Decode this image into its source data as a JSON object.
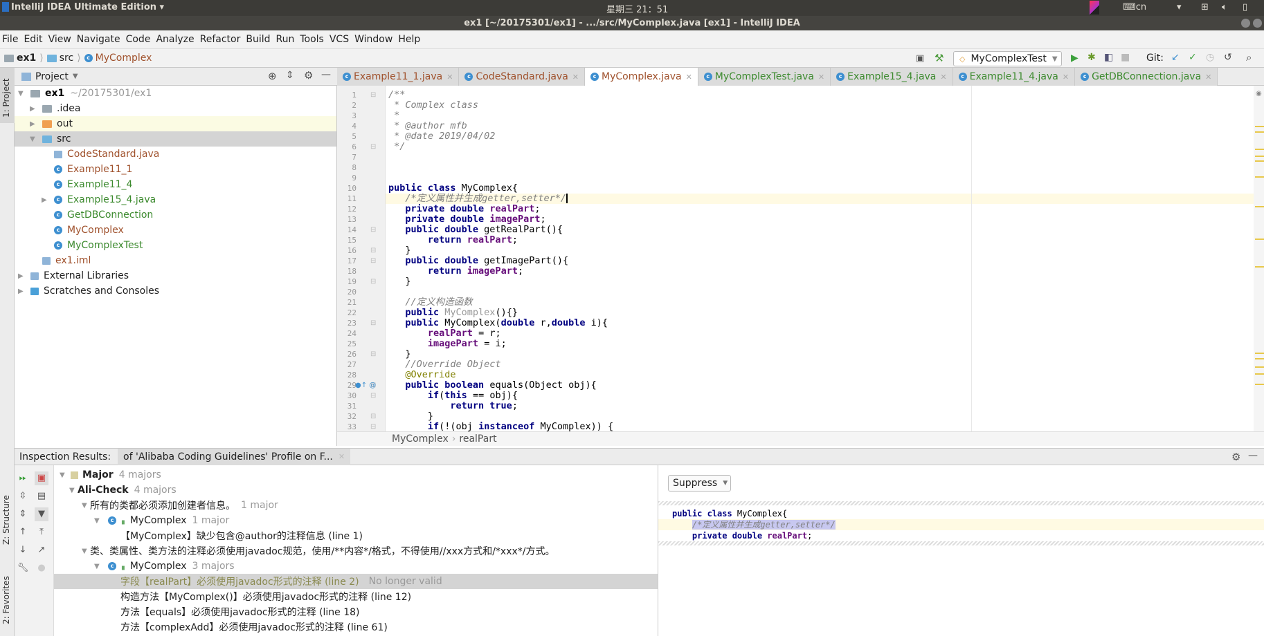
{
  "system_bar": {
    "app_name": "IntelliJ IDEA Ultimate Edition",
    "clock": "星期三 21：51",
    "input_method": "cn"
  },
  "window_title": "ex1 [~/20175301/ex1] - .../src/MyComplex.java [ex1] - IntelliJ IDEA",
  "menu": [
    "File",
    "Edit",
    "View",
    "Navigate",
    "Code",
    "Analyze",
    "Refactor",
    "Build",
    "Run",
    "Tools",
    "VCS",
    "Window",
    "Help"
  ],
  "nav": {
    "crumbs": [
      "ex1",
      "src",
      "MyComplex"
    ],
    "run_config": "MyComplexTest",
    "git_label": "Git:"
  },
  "side_tabs": {
    "project": "1: Project",
    "structure": "Z: Structure",
    "favorites": "2: Favorites"
  },
  "project": {
    "title": "Project",
    "items": [
      {
        "label": "ex1",
        "extra": "~/20175301/ex1",
        "depth": 0,
        "arrow": "down",
        "icon": "module-folder",
        "color": "#000",
        "bold": true
      },
      {
        "label": ".idea",
        "depth": 1,
        "arrow": "right",
        "icon": "folder",
        "color": "#222"
      },
      {
        "label": "out",
        "depth": 1,
        "arrow": "right",
        "icon": "folder-orange",
        "color": "#222",
        "highlight": "yellow"
      },
      {
        "label": "src",
        "depth": 1,
        "arrow": "down",
        "icon": "folder-blue",
        "color": "#222",
        "highlight": "selected"
      },
      {
        "label": "CodeStandard.java",
        "depth": 2,
        "icon": "java-file",
        "color": "#a0522d"
      },
      {
        "label": "Example11_1",
        "depth": 2,
        "icon": "class-runnable",
        "color": "#a0522d"
      },
      {
        "label": "Example11_4",
        "depth": 2,
        "icon": "class-runnable",
        "color": "#3c8a2e"
      },
      {
        "label": "Example15_4.java",
        "depth": 2,
        "arrow": "right",
        "icon": "class-runnable",
        "color": "#3c8a2e"
      },
      {
        "label": "GetDBConnection",
        "depth": 2,
        "icon": "class",
        "color": "#3c8a2e"
      },
      {
        "label": "MyComplex",
        "depth": 2,
        "icon": "class",
        "color": "#a0522d"
      },
      {
        "label": "MyComplexTest",
        "depth": 2,
        "icon": "class-runnable",
        "color": "#3c8a2e"
      },
      {
        "label": "ex1.iml",
        "depth": 1,
        "icon": "iml-file",
        "color": "#a0522d"
      },
      {
        "label": "External Libraries",
        "depth": 0,
        "arrow": "right",
        "icon": "libraries",
        "color": "#222"
      },
      {
        "label": "Scratches and Consoles",
        "depth": 0,
        "arrow": "right",
        "icon": "scratches",
        "color": "#222"
      }
    ]
  },
  "tabs": [
    {
      "label": "Example11_1.java",
      "color": "#a0522d"
    },
    {
      "label": "CodeStandard.java",
      "color": "#a0522d"
    },
    {
      "label": "MyComplex.java",
      "color": "#a0522d",
      "active": true
    },
    {
      "label": "MyComplexTest.java",
      "color": "#3c8a2e"
    },
    {
      "label": "Example15_4.java",
      "color": "#3c8a2e"
    },
    {
      "label": "Example11_4.java",
      "color": "#3c8a2e"
    },
    {
      "label": "GetDBConnection.java",
      "color": "#3c8a2e"
    }
  ],
  "code_lines": [
    [
      [
        "cm",
        "/**"
      ]
    ],
    [
      [
        "cm",
        " * Complex class"
      ]
    ],
    [
      [
        "cm",
        " *"
      ]
    ],
    [
      [
        "cm",
        " * @author mfb"
      ]
    ],
    [
      [
        "cm",
        " * @date 2019/04/02"
      ]
    ],
    [
      [
        "cm",
        " */"
      ]
    ],
    [],
    [],
    [],
    [
      [
        "kw",
        "public class "
      ],
      [
        "pl",
        "MyComplex{"
      ]
    ],
    [
      [
        "pl",
        "   "
      ],
      [
        "cm",
        "/*定义属性并生成getter,setter*/"
      ]
    ],
    [
      [
        "kw",
        "   private double "
      ],
      [
        "fd",
        "realPart"
      ],
      [
        "pl",
        ";"
      ]
    ],
    [
      [
        "kw",
        "   private double "
      ],
      [
        "fd",
        "imagePart"
      ],
      [
        "pl",
        ";"
      ]
    ],
    [
      [
        "kw",
        "   public double "
      ],
      [
        "pl",
        "getRealPart(){"
      ]
    ],
    [
      [
        "kw",
        "       return "
      ],
      [
        "fd",
        "realPart"
      ],
      [
        "pl",
        ";"
      ]
    ],
    [
      [
        "pl",
        "   }"
      ]
    ],
    [
      [
        "kw",
        "   public double "
      ],
      [
        "pl",
        "getImagePart(){"
      ]
    ],
    [
      [
        "kw",
        "       return "
      ],
      [
        "fd",
        "imagePart"
      ],
      [
        "pl",
        ";"
      ]
    ],
    [
      [
        "pl",
        "   }"
      ]
    ],
    [],
    [
      [
        "pl",
        "   "
      ],
      [
        "cm",
        "//定义构造函数"
      ]
    ],
    [
      [
        "kw",
        "   public "
      ],
      [
        "gr",
        "MyComplex"
      ],
      [
        "pl",
        "(){}"
      ]
    ],
    [
      [
        "kw",
        "   public "
      ],
      [
        "pl",
        "MyComplex("
      ],
      [
        "kw",
        "double "
      ],
      [
        "pl",
        "r,"
      ],
      [
        "kw",
        "double "
      ],
      [
        "pl",
        "i){"
      ]
    ],
    [
      [
        "pl",
        "       "
      ],
      [
        "fd",
        "realPart"
      ],
      [
        "pl",
        " = r;"
      ]
    ],
    [
      [
        "pl",
        "       "
      ],
      [
        "fd",
        "imagePart"
      ],
      [
        "pl",
        " = i;"
      ]
    ],
    [
      [
        "pl",
        "   }"
      ]
    ],
    [
      [
        "pl",
        "   "
      ],
      [
        "cm",
        "//Override Object"
      ]
    ],
    [
      [
        "pl",
        "   "
      ],
      [
        "an",
        "@Override"
      ]
    ],
    [
      [
        "kw",
        "   public boolean "
      ],
      [
        "pl",
        "equals(Object obj){"
      ]
    ],
    [
      [
        "kw",
        "       if"
      ],
      [
        "pl",
        "("
      ],
      [
        "kw",
        "this"
      ],
      [
        "pl",
        " == obj){"
      ]
    ],
    [
      [
        "kw",
        "           return true"
      ],
      [
        "pl",
        ";"
      ]
    ],
    [
      [
        "pl",
        "       }"
      ]
    ],
    [
      [
        "kw",
        "       if"
      ],
      [
        "pl",
        "(!(obj "
      ],
      [
        "kw",
        "instanceof "
      ],
      [
        "pl",
        "MyComplex)) {"
      ]
    ]
  ],
  "editor_breadcrumb": [
    "MyComplex",
    "realPart"
  ],
  "inspection": {
    "title": "Inspection Results:",
    "tab": "of 'Alibaba Coding Guidelines' Profile on F...",
    "rows": [
      {
        "label": "Major",
        "count": "4 majors",
        "level": 0,
        "arrow": true,
        "bold": true,
        "icon": "severity"
      },
      {
        "label": "Ali-Check",
        "count": "4 majors",
        "level": 1,
        "arrow": true,
        "bold": true
      },
      {
        "label": "所有的类都必须添加创建者信息。",
        "count": "1 major",
        "level": 2,
        "arrow": true
      },
      {
        "label": "MyComplex",
        "count": "1 major",
        "level": 3,
        "arrow": true,
        "icon": "class"
      },
      {
        "label": "【MyComplex】缺少包含@author的注释信息 (line 1)",
        "level": 4
      },
      {
        "label": "类、类属性、类方法的注释必须使用javadoc规范，使用/**内容*/格式，不得使用//xxx方式和/*xxx*/方式。",
        "level": 2,
        "arrow": true
      },
      {
        "label": "MyComplex",
        "count": "3 majors",
        "level": 3,
        "arrow": true,
        "icon": "class"
      },
      {
        "label": "字段【realPart】必须使用javadoc形式的注释 (line 2)",
        "count": "No longer valid",
        "level": 4,
        "selected": true
      },
      {
        "label": "构造方法【MyComplex()】必须使用javadoc形式的注释 (line 12)",
        "level": 4
      },
      {
        "label": "方法【equals】必须使用javadoc形式的注释 (line 18)",
        "level": 4
      },
      {
        "label": "方法【complexAdd】必须使用javadoc形式的注释 (line 61)",
        "level": 4
      }
    ]
  },
  "preview": {
    "suppress_label": "Suppress",
    "lines": [
      [
        [
          "kw",
          "public class "
        ],
        [
          "pl",
          "MyComplex{"
        ]
      ],
      [
        [
          "pl",
          "    "
        ],
        [
          "cm",
          "/*定义属性并生成getter,setter*/"
        ]
      ],
      [
        [
          "kw",
          "    private double "
        ],
        [
          "fd",
          "realPart"
        ],
        [
          "pl",
          ";"
        ]
      ]
    ]
  },
  "colors": {
    "accent": "#3d8fd0",
    "selection": "#d4d4d4",
    "caret_row": "#fffae3"
  }
}
